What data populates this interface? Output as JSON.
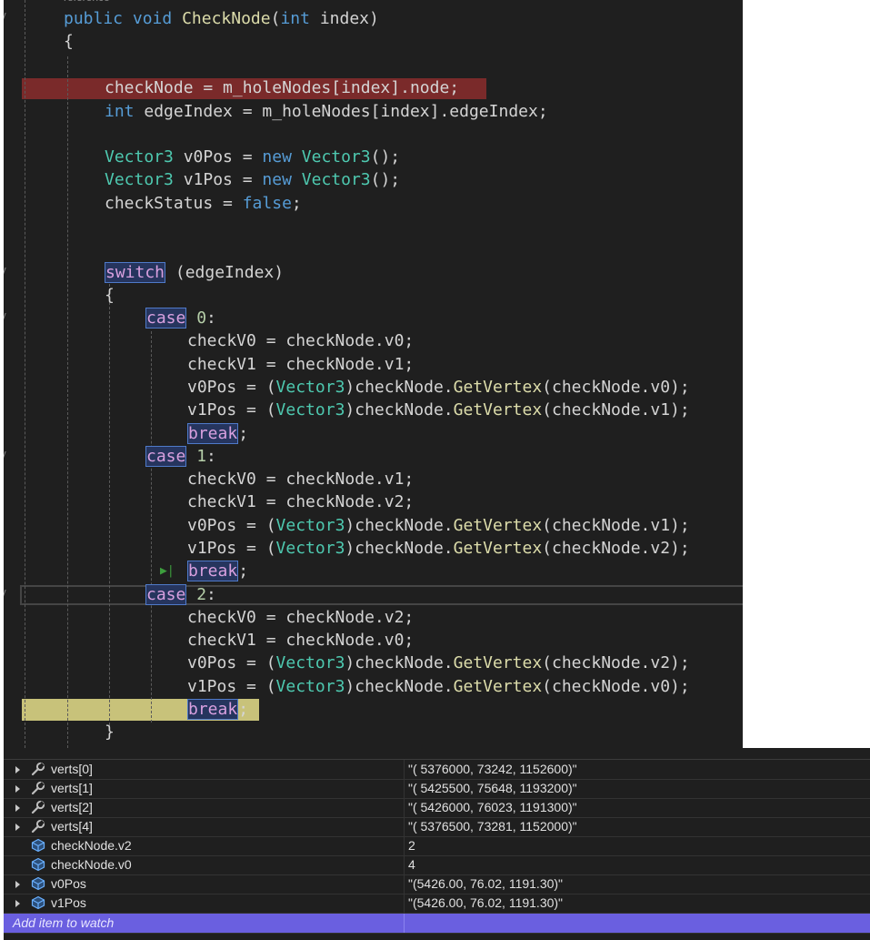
{
  "editor": {
    "reference_hint": "reference",
    "lines": [
      {
        "tokens": [
          {
            "c": "kw",
            "t": "public"
          },
          {
            "c": "",
            "t": " "
          },
          {
            "c": "kw",
            "t": "void"
          },
          {
            "c": "",
            "t": " "
          },
          {
            "c": "fn",
            "t": "CheckNode"
          },
          {
            "c": "",
            "t": "("
          },
          {
            "c": "kw",
            "t": "int"
          },
          {
            "c": "",
            "t": " index)"
          }
        ]
      },
      {
        "tokens": [
          {
            "c": "",
            "t": "{"
          }
        ]
      },
      {
        "tokens": [
          {
            "c": "",
            "t": "checkNode = m_holeNodes[index].node;"
          }
        ]
      },
      {
        "tokens": [
          {
            "c": "kw",
            "t": "int"
          },
          {
            "c": "",
            "t": " edgeIndex = m_holeNodes[index].edgeIndex;"
          }
        ]
      },
      {
        "tokens": [
          {
            "c": "ty",
            "t": "Vector3"
          },
          {
            "c": "",
            "t": " v0Pos = "
          },
          {
            "c": "kw",
            "t": "new"
          },
          {
            "c": "",
            "t": " "
          },
          {
            "c": "ty",
            "t": "Vector3"
          },
          {
            "c": "",
            "t": "();"
          }
        ]
      },
      {
        "tokens": [
          {
            "c": "ty",
            "t": "Vector3"
          },
          {
            "c": "",
            "t": " v1Pos = "
          },
          {
            "c": "kw",
            "t": "new"
          },
          {
            "c": "",
            "t": " "
          },
          {
            "c": "ty",
            "t": "Vector3"
          },
          {
            "c": "",
            "t": "();"
          }
        ]
      },
      {
        "tokens": [
          {
            "c": "",
            "t": "checkStatus = "
          },
          {
            "c": "kw",
            "t": "false"
          },
          {
            "c": "",
            "t": ";"
          }
        ]
      },
      {
        "tokens": [
          {
            "c": "ctl box",
            "t": "switch"
          },
          {
            "c": "",
            "t": " (edgeIndex)"
          }
        ]
      },
      {
        "tokens": [
          {
            "c": "",
            "t": "{"
          }
        ]
      },
      {
        "tokens": [
          {
            "c": "ctl box",
            "t": "case"
          },
          {
            "c": "",
            "t": " "
          },
          {
            "c": "nu",
            "t": "0"
          },
          {
            "c": "",
            "t": ":"
          }
        ]
      },
      {
        "tokens": [
          {
            "c": "",
            "t": "checkV0 = checkNode.v0;"
          }
        ]
      },
      {
        "tokens": [
          {
            "c": "",
            "t": "checkV1 = checkNode.v1;"
          }
        ]
      },
      {
        "tokens": [
          {
            "c": "",
            "t": "v0Pos = ("
          },
          {
            "c": "ty",
            "t": "Vector3"
          },
          {
            "c": "",
            "t": ")checkNode."
          },
          {
            "c": "fn",
            "t": "GetVertex"
          },
          {
            "c": "",
            "t": "(checkNode.v0);"
          }
        ]
      },
      {
        "tokens": [
          {
            "c": "",
            "t": "v1Pos = ("
          },
          {
            "c": "ty",
            "t": "Vector3"
          },
          {
            "c": "",
            "t": ")checkNode."
          },
          {
            "c": "fn",
            "t": "GetVertex"
          },
          {
            "c": "",
            "t": "(checkNode.v1);"
          }
        ]
      },
      {
        "tokens": [
          {
            "c": "ctl box",
            "t": "break"
          },
          {
            "c": "",
            "t": ";"
          }
        ]
      },
      {
        "tokens": [
          {
            "c": "ctl box",
            "t": "case"
          },
          {
            "c": "",
            "t": " "
          },
          {
            "c": "nu",
            "t": "1"
          },
          {
            "c": "",
            "t": ":"
          }
        ]
      },
      {
        "tokens": [
          {
            "c": "",
            "t": "checkV0 = checkNode.v1;"
          }
        ]
      },
      {
        "tokens": [
          {
            "c": "",
            "t": "checkV1 = checkNode.v2;"
          }
        ]
      },
      {
        "tokens": [
          {
            "c": "",
            "t": "v0Pos = ("
          },
          {
            "c": "ty",
            "t": "Vector3"
          },
          {
            "c": "",
            "t": ")checkNode."
          },
          {
            "c": "fn",
            "t": "GetVertex"
          },
          {
            "c": "",
            "t": "(checkNode.v1);"
          }
        ]
      },
      {
        "tokens": [
          {
            "c": "",
            "t": "v1Pos = ("
          },
          {
            "c": "ty",
            "t": "Vector3"
          },
          {
            "c": "",
            "t": ")checkNode."
          },
          {
            "c": "fn",
            "t": "GetVertex"
          },
          {
            "c": "",
            "t": "(checkNode.v2);"
          }
        ]
      },
      {
        "tokens": [
          {
            "c": "ctl box",
            "t": "break"
          },
          {
            "c": "",
            "t": ";"
          }
        ]
      },
      {
        "tokens": [
          {
            "c": "ctl box",
            "t": "case"
          },
          {
            "c": "",
            "t": " "
          },
          {
            "c": "nu",
            "t": "2"
          },
          {
            "c": "",
            "t": ":"
          }
        ]
      },
      {
        "tokens": [
          {
            "c": "",
            "t": "checkV0 = checkNode.v2;"
          }
        ]
      },
      {
        "tokens": [
          {
            "c": "",
            "t": "checkV1 = checkNode.v0;"
          }
        ]
      },
      {
        "tokens": [
          {
            "c": "",
            "t": "v0Pos = ("
          },
          {
            "c": "ty",
            "t": "Vector3"
          },
          {
            "c": "",
            "t": ")checkNode."
          },
          {
            "c": "fn",
            "t": "GetVertex"
          },
          {
            "c": "",
            "t": "(checkNode.v2);"
          }
        ]
      },
      {
        "tokens": [
          {
            "c": "",
            "t": "v1Pos = ("
          },
          {
            "c": "ty",
            "t": "Vector3"
          },
          {
            "c": "",
            "t": ")checkNode."
          },
          {
            "c": "fn",
            "t": "GetVertex"
          },
          {
            "c": "",
            "t": "(checkNode.v0);"
          }
        ]
      },
      {
        "tokens": [
          {
            "c": "ctl box",
            "t": "break"
          },
          {
            "c": "",
            "t": ";"
          }
        ]
      },
      {
        "tokens": [
          {
            "c": "",
            "t": "}"
          }
        ]
      }
    ]
  },
  "watch": {
    "rows": [
      {
        "name": "verts[0]",
        "value": "\"( 5376000, 73242, 1152600)\"",
        "icon": "wrench-icon",
        "expandable": true
      },
      {
        "name": "verts[1]",
        "value": "\"( 5425500, 75648, 1193200)\"",
        "icon": "wrench-icon",
        "expandable": true
      },
      {
        "name": "verts[2]",
        "value": "\"( 5426000, 76023, 1191300)\"",
        "icon": "wrench-icon",
        "expandable": true
      },
      {
        "name": "verts[4]",
        "value": "\"( 5376500, 73281, 1152000)\"",
        "icon": "wrench-icon",
        "expandable": true
      },
      {
        "name": "checkNode.v2",
        "value": "2",
        "icon": "field-icon",
        "expandable": false
      },
      {
        "name": "checkNode.v0",
        "value": "4",
        "icon": "field-icon",
        "expandable": false
      },
      {
        "name": "v0Pos",
        "value": "\"(5426.00, 76.02, 1191.30)\"",
        "icon": "field-icon",
        "expandable": true
      },
      {
        "name": "v1Pos",
        "value": "\"(5426.00, 76.02, 1191.30)\"",
        "icon": "field-icon",
        "expandable": true
      }
    ],
    "add_item_label": "Add item to watch"
  }
}
